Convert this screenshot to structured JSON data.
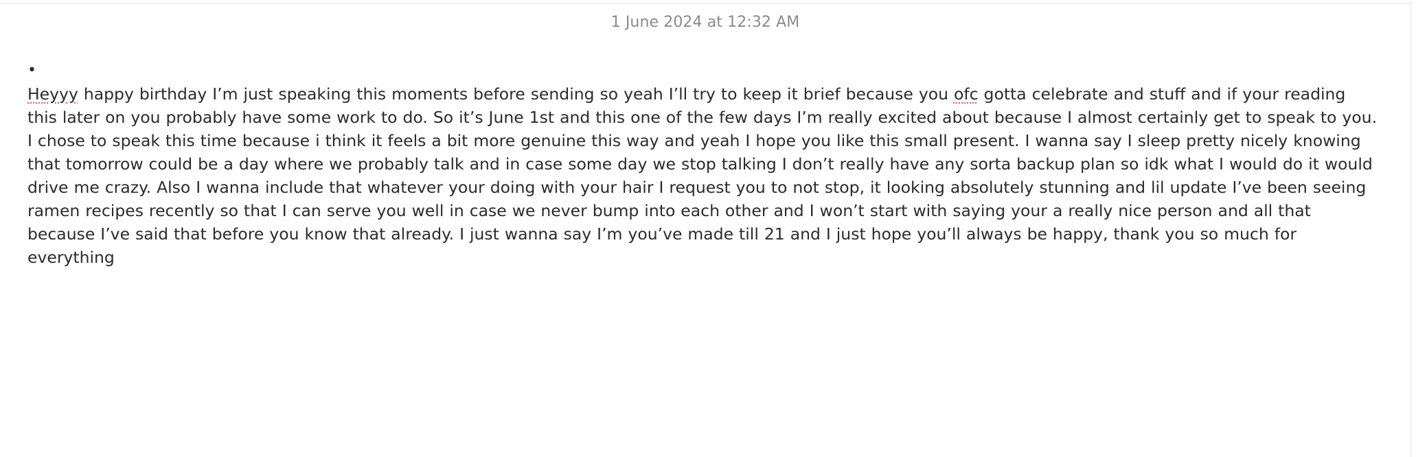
{
  "note": {
    "date": "1 June 2024 at 12:32 AM",
    "bullet": "•",
    "paragraph": {
      "word1": "Heyyy",
      "text1": " happy birthday I’m just speaking this moments before sending so yeah I’ll try to keep it brief because you ",
      "word2": "ofc",
      "text2": " gotta celebrate and stuff and if your reading this later on you probably have some work to do. So it’s June 1st and this one of the few days I’m really excited about because I almost certainly get to speak to you. I chose to speak this time because i think it feels a bit more genuine this way and yeah I hope you like this small present. I wanna say I sleep pretty nicely knowing that tomorrow could be a day where we probably talk and in case some day we stop talking I don’t really have any sorta backup plan so idk what I would do it would drive me crazy. Also I wanna include that whatever your doing with your hair I request you to not stop, it looking absolutely stunning and lil update I’ve been seeing ramen recipes recently so that I can serve you well in case we never bump into each other and I won’t start with saying your a really nice person and all that because I’ve said that before you know that already. I just wanna say I’m you’ve made till 21 and I just hope you’ll always be happy, thank you so much for everything"
    }
  }
}
